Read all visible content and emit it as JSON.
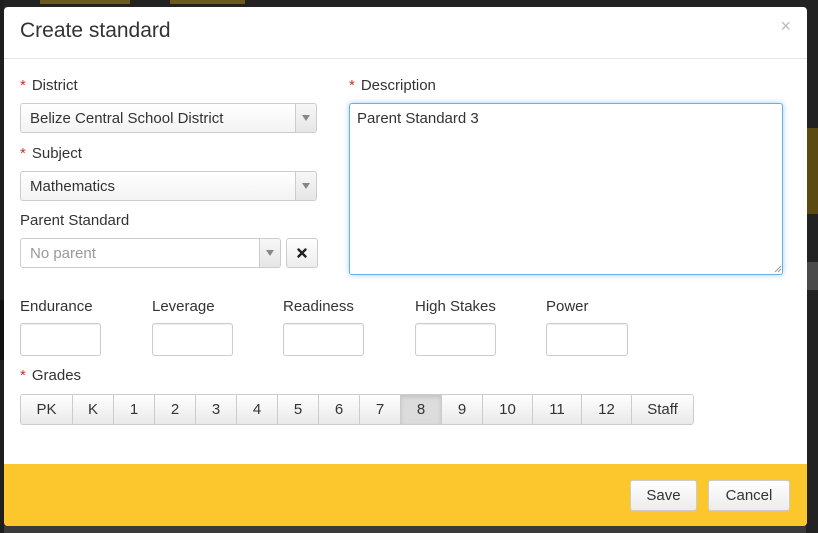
{
  "modal": {
    "title": "Create standard",
    "close_glyph": "×"
  },
  "form": {
    "required_mark": "*",
    "district": {
      "label": "District",
      "value": "Belize Central School District"
    },
    "subject": {
      "label": "Subject",
      "value": "Mathematics"
    },
    "parent_standard": {
      "label": "Parent Standard",
      "placeholder": "No parent"
    },
    "description": {
      "label": "Description",
      "value": "Parent Standard 3"
    },
    "metrics": [
      {
        "label": "Endurance"
      },
      {
        "label": "Leverage"
      },
      {
        "label": "Readiness"
      },
      {
        "label": "High Stakes"
      },
      {
        "label": "Power"
      }
    ],
    "grades": {
      "label": "Grades",
      "options": [
        "PK",
        "K",
        "1",
        "2",
        "3",
        "4",
        "5",
        "6",
        "7",
        "8",
        "9",
        "10",
        "11",
        "12",
        "Staff"
      ],
      "selected": "8"
    }
  },
  "footer": {
    "save_label": "Save",
    "cancel_label": "Cancel"
  },
  "colors": {
    "footer_bg": "#fcc72d",
    "required": "#c9302c",
    "focus_border": "#66afe9"
  },
  "icons": {
    "close": "close-icon",
    "dropdown": "chevron-down-icon",
    "clear": "clear-x-icon"
  }
}
